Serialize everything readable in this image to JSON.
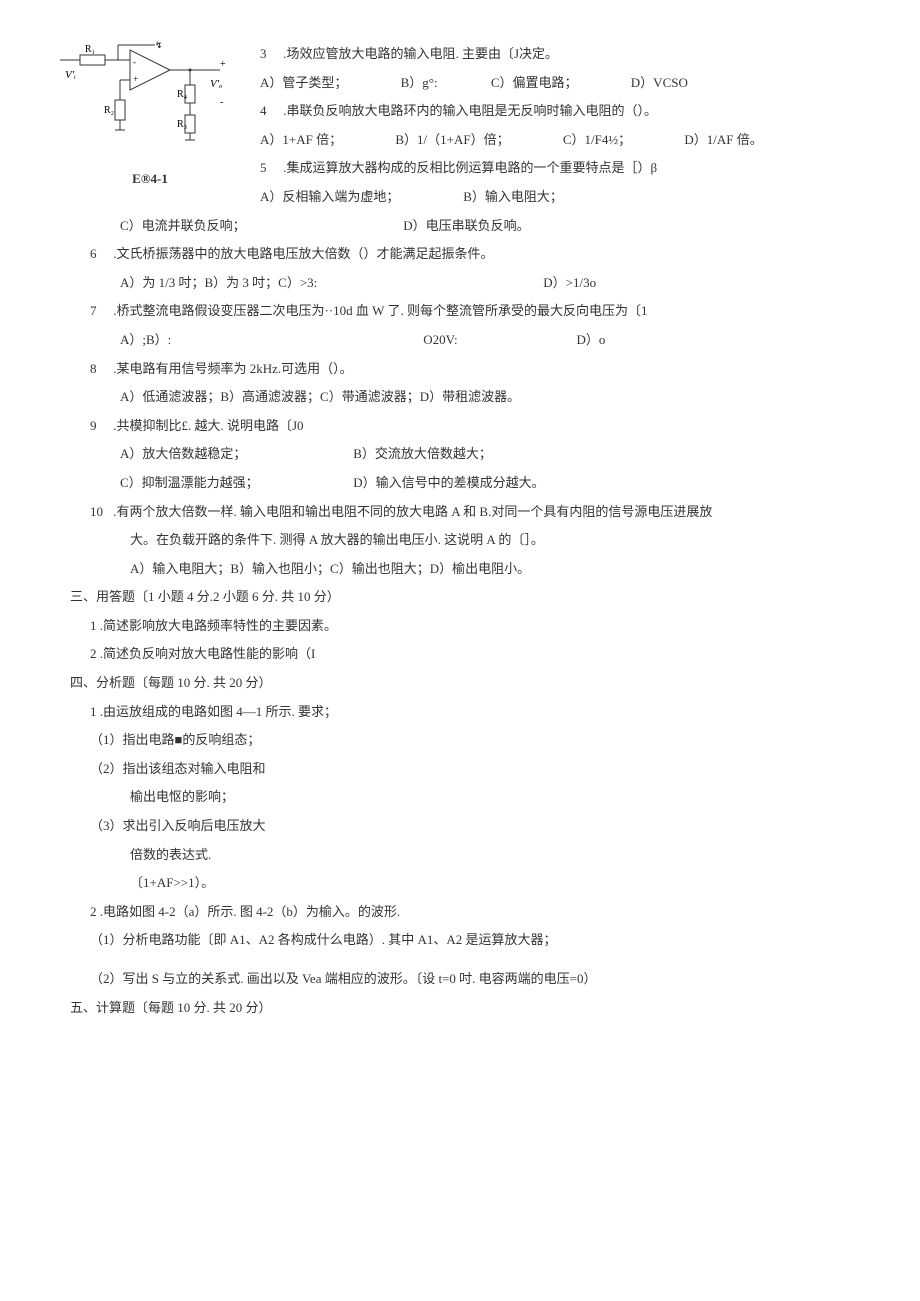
{
  "circuit_caption": "E®4-1",
  "q3": {
    "num": "3",
    "text": ".场效应管放大电路的输入电阻. 主要由〔J决定。",
    "opts": [
      "A）管子类型；",
      "B）g°:",
      "C）偏置电路；",
      "D）VCSO"
    ]
  },
  "q4": {
    "num": "4",
    "text": ".串联负反响放大电路环内的输入电阻是无反响时输入电阻的（）。",
    "opts": [
      "A）1+AF 倍；",
      "B）1/（1+AF）倍；",
      "C）1/F4½；",
      "D）1/AF 倍。"
    ]
  },
  "q5": {
    "num": "5",
    "text": ".集成运算放大器构成的反相比例运算电路的一个重要特点是［）β",
    "opts": [
      "A）反相输入端为虚地；",
      "B）输入电阻大；",
      "C）电流并联负反响；",
      "D）电压串联负反响。"
    ]
  },
  "q6": {
    "num": "6",
    "text": ".文氏桥振荡器中的放大电路电压放大倍数（）才能满足起振条件。",
    "opts": [
      "A）为 1/3 吋；B）为 3 吋；C）>3:",
      "D）>1/3o"
    ]
  },
  "q7": {
    "num": "7",
    "text": ".桥式整流电路假设变压器二次电压为··10d 血 W 了. 则每个整流管所承受的最大反向电压为〔1",
    "opts": [
      "A）;B）:",
      "O20V:",
      "D）o"
    ]
  },
  "q8": {
    "num": "8",
    "text": ".某电路有用信号频率为 2kHz.可选用（）。",
    "opts_line": "A）低通滤波器；B）高通滤波器；C）带通滤波器；D）带租滤波器。"
  },
  "q9": {
    "num": "9",
    "text": ".共模抑制比£. 越大. 说明电路〔J0",
    "opts": [
      "A）放大倍数越稳定；",
      "B）交流放大倍数越大；",
      "C）抑制温漂能力越强；",
      "D）输入信号中的差模成分越大。"
    ]
  },
  "q10": {
    "num": "10",
    "text": ".有两个放大倍数一样. 输入电阻和输出电阻不同的放大电路 A 和 B.对同一个具有内阻的信号源电压进展放",
    "text2": "大。在负载开路的条件下. 测得 A 放大器的输出电压小. 这说明 A 的〔］。",
    "opts_line": "A）输入电阻大；B）输入也阻小；C）输出也阻大；D）榆出电阻小。"
  },
  "sec3": {
    "header": "三、用答题〔1 小题 4 分.2 小题 6 分. 共 10 分）",
    "q1": "1   .简述影响放大电路频率特性的主要因素。",
    "q2": "2   .简述负反响对放大电路性能的影响（I"
  },
  "sec4": {
    "header": "四、分析题〔每题 10 分. 共 20 分）",
    "q1": "1   .由运放组成的电路如图 4—1 所示. 要求；",
    "q1_1": "（1）指出电路■的反响组态；",
    "q1_2": "（2）指出该组态对输入电阻和",
    "q1_2b": "榆出电怄的影响；",
    "q1_3": "（3）求出引入反响后电压放大",
    "q1_3b": "倍数的表达式.",
    "q1_3c": "〔1+AF>>1）。",
    "q2": "2   .电路如图 4-2（a）所示. 图 4-2（b）为榆入。的波形.",
    "q2_1": "（1）分析电路功能〔即 A1、A2 各构成什么电路）. 其中 A1、A2 是运算放大器；",
    "q2_2": "（2）写出 S 与立的关系式. 画出以及 Vea 端相应的波形。〔设 t=0 吋. 电容两端的电压=0）"
  },
  "sec5": {
    "header": "五、计算题〔每题 10 分. 共 20 分）"
  }
}
